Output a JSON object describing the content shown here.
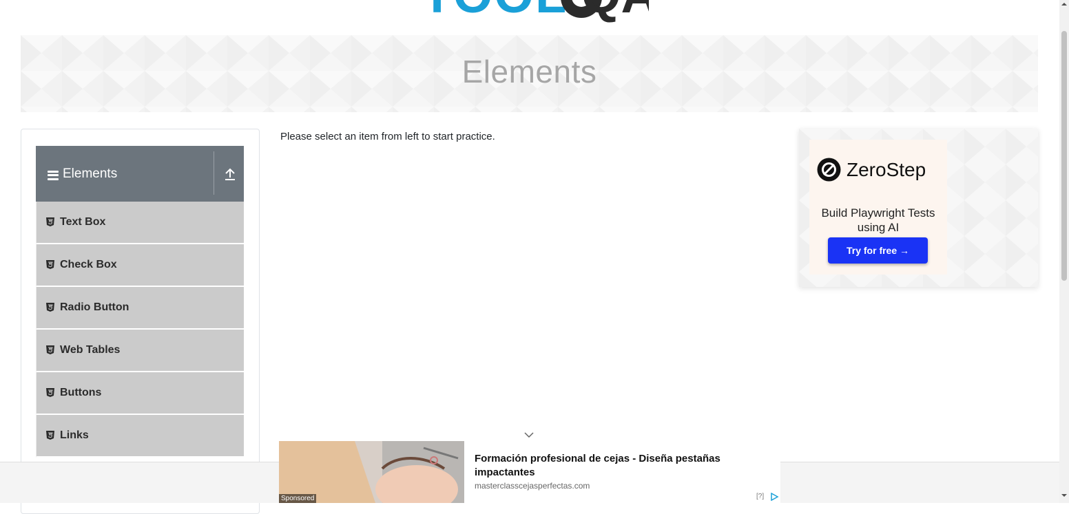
{
  "colors": {
    "brand_blue": "#1aa0d8",
    "brand_dark": "#2b2b2b",
    "header_gray": "#6c757d",
    "item_gray": "#cbcbcb",
    "cta_blue": "#1a33f5"
  },
  "logo": {
    "text_left": "TOOLS",
    "text_right": "QA"
  },
  "banner": {
    "title": "Elements"
  },
  "sidebar": {
    "group": {
      "title": "Elements",
      "menu_icon": "hamburger-icon",
      "collapse_icon": "arrow-up-icon"
    },
    "items": [
      {
        "label": "Text Box",
        "icon": "html5-icon"
      },
      {
        "label": "Check Box",
        "icon": "html5-icon"
      },
      {
        "label": "Radio Button",
        "icon": "html5-icon"
      },
      {
        "label": "Web Tables",
        "icon": "html5-icon"
      },
      {
        "label": "Buttons",
        "icon": "html5-icon"
      },
      {
        "label": "Links",
        "icon": "html5-icon"
      }
    ]
  },
  "main": {
    "instruction": "Please select an item from left to start practice."
  },
  "side_ad": {
    "brand": "ZeroStep",
    "tagline": "Build Playwright Tests using AI",
    "cta": "Try for free →"
  },
  "bottom_ad": {
    "sponsored": "Sponsored",
    "headline": "Formación profesional de cejas - Diseña pestañas impactantes",
    "domain": "masterclasscejasperfectas.com",
    "info": "[?]"
  }
}
